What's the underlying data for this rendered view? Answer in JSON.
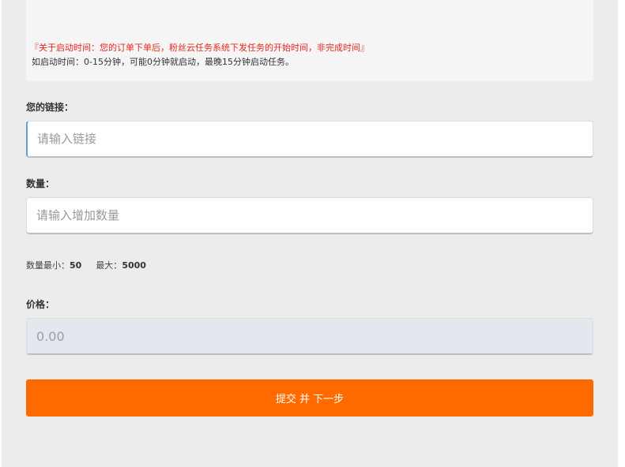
{
  "notice": {
    "start_time_note": "『关于启动时间：您的订单下单后，粉丝云任务系统下发任务的开始时间，非完成时间』",
    "start_time_example": "如启动时间：0-15分钟，可能0分钟就启动，最晚15分钟启动任务。"
  },
  "form": {
    "link_label": "您的链接：",
    "link_placeholder": "请输入链接",
    "link_value": "",
    "quantity_label": "数量：",
    "quantity_placeholder": "请输入增加数量",
    "quantity_value": "",
    "min_label": "数量最小：",
    "min_value": "50",
    "max_label": "最大：",
    "max_value": "5000",
    "price_label": "价格：",
    "price_value": "0.00",
    "submit_label": "提交 并 下一步"
  },
  "colors": {
    "accent": "#ff6a00",
    "notice_text": "#e8281b"
  }
}
